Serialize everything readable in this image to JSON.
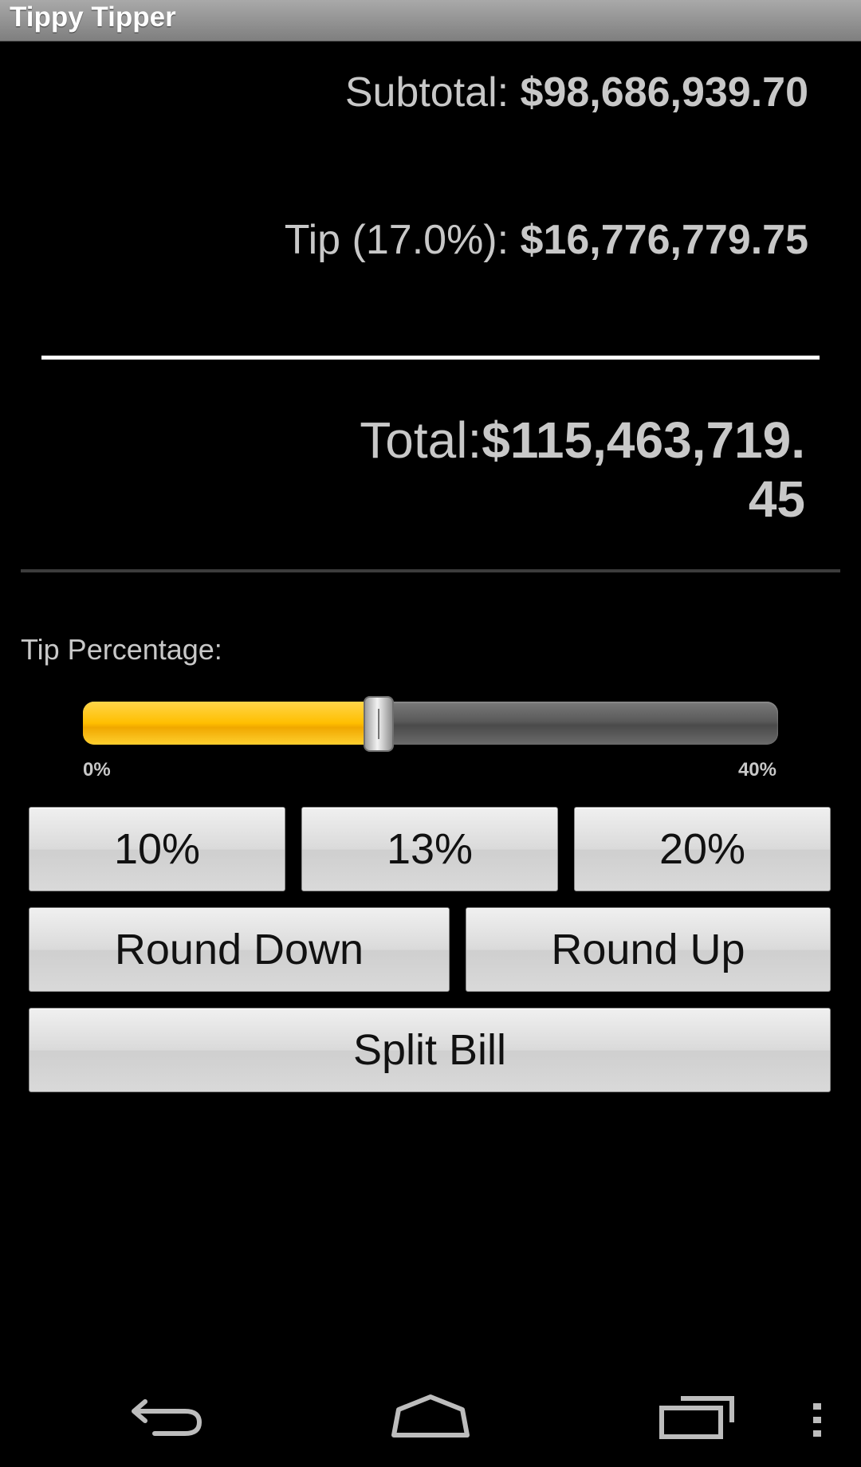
{
  "app": {
    "title": "Tippy Tipper"
  },
  "summary": {
    "subtotal_label": "Subtotal: ",
    "subtotal_value": "$98,686,939.70",
    "tip_label": "Tip (17.0%): ",
    "tip_value": "$16,776,779.75",
    "total_label": "Total:",
    "total_value": "$115,463,719.45"
  },
  "tip_slider": {
    "label": "Tip Percentage:",
    "min_label": "0%",
    "max_label": "40%",
    "value_fraction": 0.425,
    "fill_color": "#ffbf00"
  },
  "buttons": {
    "preset_10": "10%",
    "preset_13": "13%",
    "preset_20": "20%",
    "round_down": "Round Down",
    "round_up": "Round Up",
    "split_bill": "Split Bill"
  },
  "navbar": {
    "icons": [
      "back-icon",
      "home-icon",
      "recent-apps-icon",
      "overflow-menu-icon"
    ]
  }
}
